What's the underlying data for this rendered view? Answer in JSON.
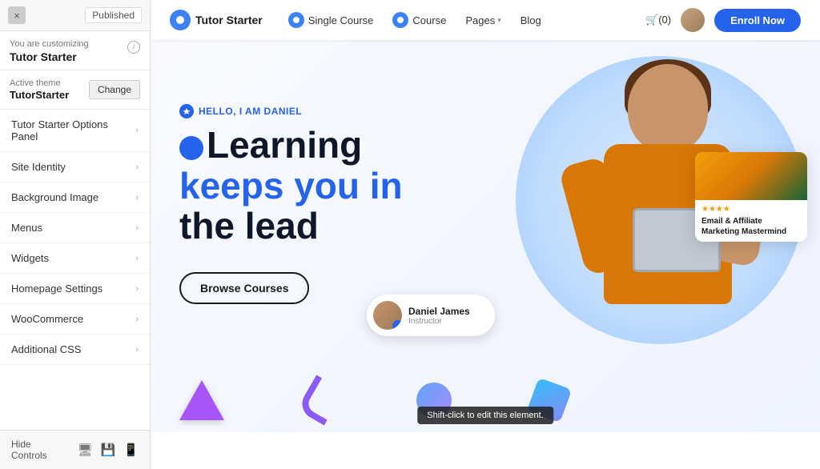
{
  "panel": {
    "close_icon": "×",
    "published_label": "Published",
    "customizing_label": "You are customizing",
    "theme_title": "Tutor Starter",
    "active_theme_label": "Active theme",
    "theme_name": "TutorStarter",
    "change_button": "Change",
    "menu_items": [
      "Tutor Starter Options Panel",
      "Site Identity",
      "Background Image",
      "Menus",
      "Widgets",
      "Homepage Settings",
      "WooCommerce",
      "Additional CSS"
    ],
    "hide_controls": "Hide Controls",
    "info_icon": "i"
  },
  "nav": {
    "logo_text": "Tutor Starter",
    "links": [
      {
        "label": "Single Course",
        "has_icon": true
      },
      {
        "label": "Course",
        "has_icon": true
      },
      {
        "label": "Pages",
        "has_dropdown": true
      },
      {
        "label": "Blog"
      }
    ],
    "cart_label": "🛒(0)",
    "enroll_btn": "Enroll Now"
  },
  "hero": {
    "tag": "HELLO, I AM DANIEL",
    "title_line1": "Learning",
    "title_line2": "keeps you in",
    "title_line3": "the lead",
    "browse_btn": "Browse Courses"
  },
  "card_course": {
    "stars": "★★★★",
    "title": "Email & Affiliate Marketing Mastermind"
  },
  "card_instructor": {
    "name": "Daniel James",
    "role": "Instructor"
  },
  "tooltip": {
    "text": "Shift-click to edit this element."
  }
}
